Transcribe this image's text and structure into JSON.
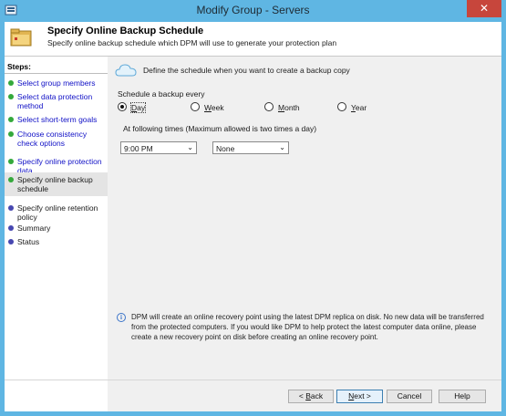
{
  "window": {
    "title": "Modify Group - Servers",
    "close_glyph": "✕",
    "app_icon": "servers-app-icon"
  },
  "header": {
    "title": "Specify Online Backup Schedule",
    "subtitle": "Specify online backup schedule which DPM will use to generate your protection plan",
    "icon": "folder-icon"
  },
  "steps": {
    "title": "Steps:",
    "items": [
      {
        "label": "Select group members",
        "status": "complete"
      },
      {
        "label": "Select data protection method",
        "status": "complete"
      },
      {
        "label": "Select short-term goals",
        "status": "complete"
      },
      {
        "label": "Choose consistency check options",
        "status": "complete"
      },
      {
        "label": "Specify online protection data",
        "status": "complete"
      },
      {
        "label": "Specify online backup schedule",
        "status": "current"
      },
      {
        "label": "Specify online retention policy",
        "status": "pending"
      },
      {
        "label": "Summary",
        "status": "pending"
      },
      {
        "label": "Status",
        "status": "pending"
      }
    ]
  },
  "main": {
    "define_text": "Define the schedule when you want to create a backup copy",
    "schedule_label": "Schedule a backup every",
    "frequency_options": [
      {
        "label": "Day",
        "accel": "D",
        "rest": "ay",
        "checked": true
      },
      {
        "label": "Week",
        "accel": "W",
        "rest": "eek",
        "checked": false
      },
      {
        "label": "Month",
        "accel": "M",
        "rest": "onth",
        "checked": false
      },
      {
        "label": "Year",
        "accel": "Y",
        "rest": "ear",
        "checked": false
      }
    ],
    "times_label": "At following times (Maximum allowed is two times a day)",
    "time_1": "9:00 PM",
    "time_2": "None",
    "info_text": "DPM will create an online recovery point using the latest DPM replica on disk. No new data will be transferred from the protected computers. If you would like DPM to help protect the latest computer data online, please create a new recovery point on disk before creating an online recovery point."
  },
  "buttons": {
    "back": {
      "label": "< Back",
      "accel": "B"
    },
    "next": {
      "label": "Next >",
      "accel": "N"
    },
    "cancel": "Cancel",
    "help": "Help"
  },
  "colors": {
    "title_bar": "#5fb6e3",
    "close": "#c7463c",
    "link": "#1010c6",
    "complete_dot": "#34a93b",
    "pending_dot": "#4747b0"
  }
}
